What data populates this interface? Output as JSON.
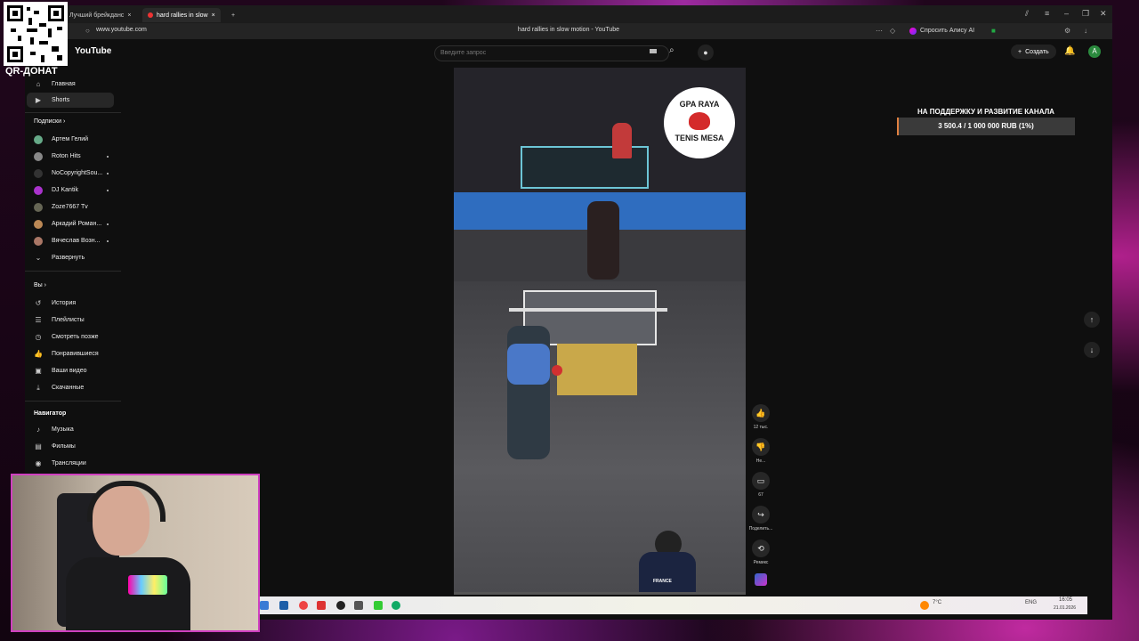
{
  "overlay": {
    "qr_label": "QR-ДОНАТ",
    "donation_title": "НА ПОДДЕРЖКУ И РАЗВИТИЕ КАНАЛА",
    "donation_progress": "3 500.4 / 1 000 000 RUB (1%)",
    "donation_fraction": 0.01
  },
  "browser": {
    "tabs": [
      {
        "label": "Лучший брейкданс"
      },
      {
        "label": "hard rallies in slow"
      }
    ],
    "url": "www.youtube.com",
    "page_title": "hard rallies in slow motion - YouTube",
    "alice_label": "Спросить Алису AI"
  },
  "youtube": {
    "logo_text": "YouTube",
    "search_placeholder": "Введите запрос",
    "create_label": "Создать",
    "avatar_letter": "A"
  },
  "sidebar": {
    "top": [
      {
        "label": "Главная",
        "icon": "home-icon"
      },
      {
        "label": "Shorts",
        "icon": "shorts-icon"
      }
    ],
    "subscriptions_heading": "Подписки",
    "subscriptions": [
      {
        "label": "Артем Гелий",
        "color": "#6a8"
      },
      {
        "label": "Roton Hits",
        "color": "#888"
      },
      {
        "label": "NoCopyrightSou...",
        "color": "#333"
      },
      {
        "label": "DJ Kantik",
        "color": "#a3c"
      },
      {
        "label": "Zoze7667 Tv",
        "color": "#665"
      },
      {
        "label": "Аркадий Роман...",
        "color": "#b85"
      },
      {
        "label": "Вячеслав Возн...",
        "color": "#a76"
      }
    ],
    "expand_label": "Развернуть",
    "you_heading": "Вы",
    "you_items": [
      {
        "label": "История",
        "icon": "history-icon"
      },
      {
        "label": "Плейлисты",
        "icon": "playlist-icon"
      },
      {
        "label": "Смотреть позже",
        "icon": "clock-icon"
      },
      {
        "label": "Понравившиеся",
        "icon": "thumb-up-icon"
      },
      {
        "label": "Ваши видео",
        "icon": "video-icon"
      },
      {
        "label": "Скачанные",
        "icon": "download-icon"
      }
    ],
    "navigator_heading": "Навигатор",
    "navigator_items": [
      {
        "label": "Музыка",
        "icon": "music-icon"
      },
      {
        "label": "Фильмы",
        "icon": "film-icon"
      },
      {
        "label": "Трансляции",
        "icon": "live-icon"
      }
    ]
  },
  "video": {
    "logo_top": "GPA RAYA",
    "logo_bottom": "TENIS MESA",
    "bottom_text": "FRANCE",
    "progress_fraction": 0.0
  },
  "actions": [
    {
      "name": "like-button",
      "icon": "thumb-up-icon",
      "label": "12 тыс."
    },
    {
      "name": "dislike-button",
      "icon": "thumb-down-icon",
      "label": "Не..."
    },
    {
      "name": "comments-button",
      "icon": "comment-icon",
      "label": "67"
    },
    {
      "name": "share-button",
      "icon": "share-icon",
      "label": "Поделить..."
    },
    {
      "name": "remix-button",
      "icon": "remix-icon",
      "label": "Ремикс"
    }
  ],
  "taskbar": {
    "weather": "7°C",
    "lang": "ENG",
    "time": "16:05",
    "date": "21.01.2026"
  }
}
